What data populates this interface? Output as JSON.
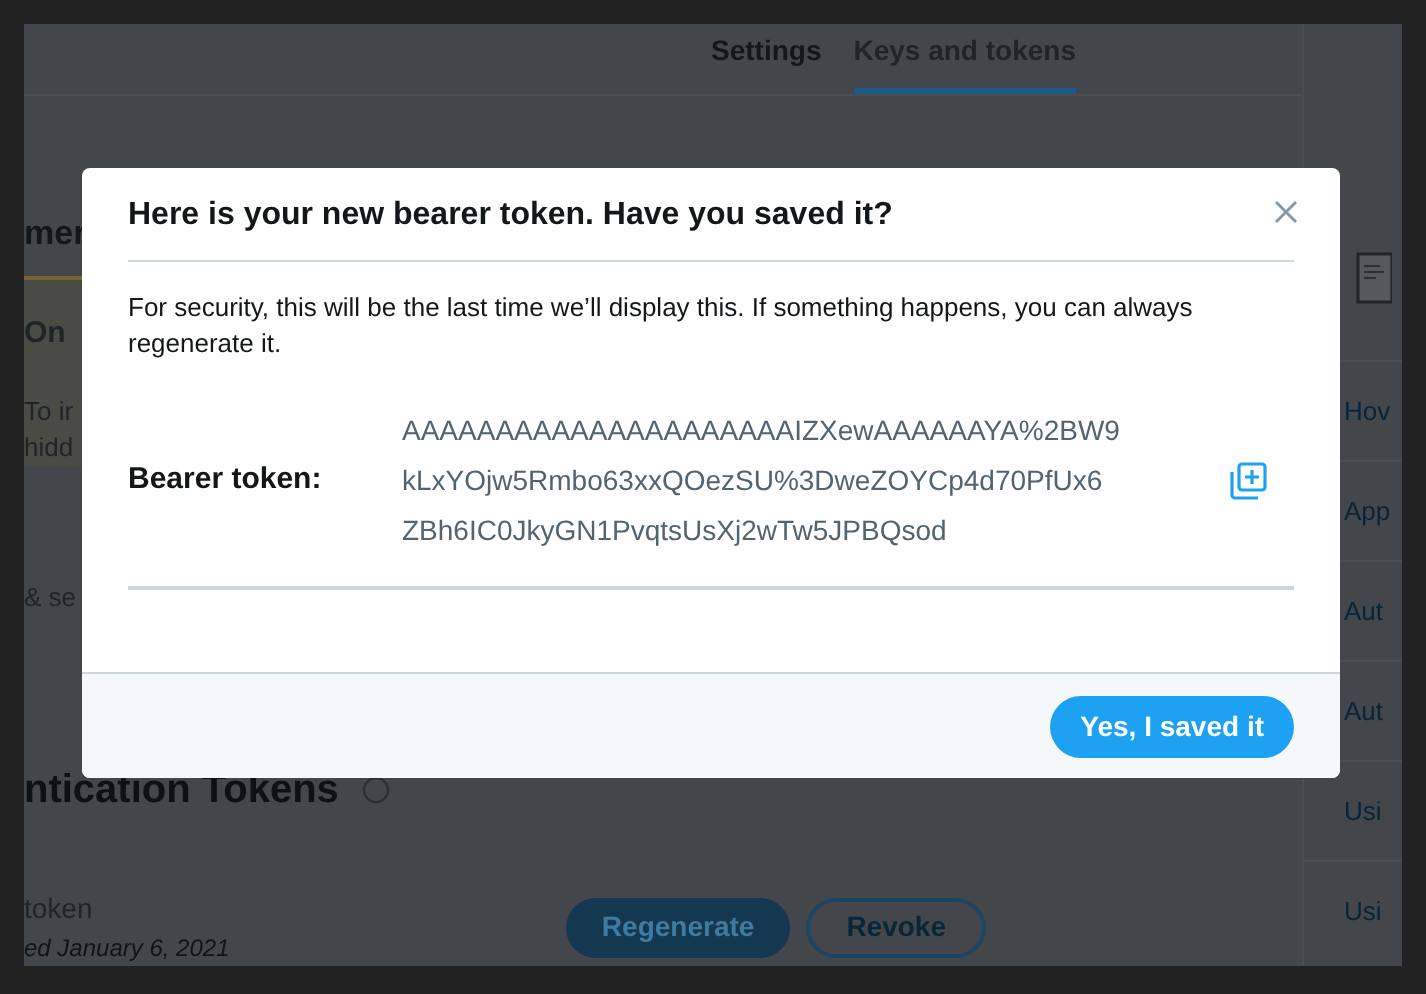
{
  "page": {
    "tabs": [
      {
        "label": "Settings",
        "selected": false
      },
      {
        "label": "Keys and tokens",
        "selected": true
      }
    ],
    "heading": "mer",
    "notice": {
      "title": "On",
      "lines": [
        "To ir",
        "hidd"
      ]
    },
    "section_text": "& se",
    "tokens_heading": "ntication Tokens",
    "token": {
      "name": "token",
      "date": "ed January 6, 2021",
      "buttons": [
        "Regenerate",
        "Revoke"
      ]
    },
    "sidebar_links": [
      "Hov",
      "App",
      "Aut",
      "Aut",
      "Usi",
      "Usi"
    ]
  },
  "dialog": {
    "title": "Here is your new bearer token. Have you saved it?",
    "message": "For security, this will be the last time we’ll display this. If something happens, you can always regenerate it.",
    "token_label": "Bearer token:",
    "token_lines": [
      "AAAAAAAAAAAAAAAAAAAAAIZXewAAAAAAYA%2BW9",
      "kLxYOjw5Rmbo63xxQOezSU%3DweZOYCp4d70PfUx6",
      "ZBh6IC0JkyGN1PvqtsUsXj2wTw5JPBQsod"
    ],
    "confirm_button": "Yes, I saved it"
  }
}
